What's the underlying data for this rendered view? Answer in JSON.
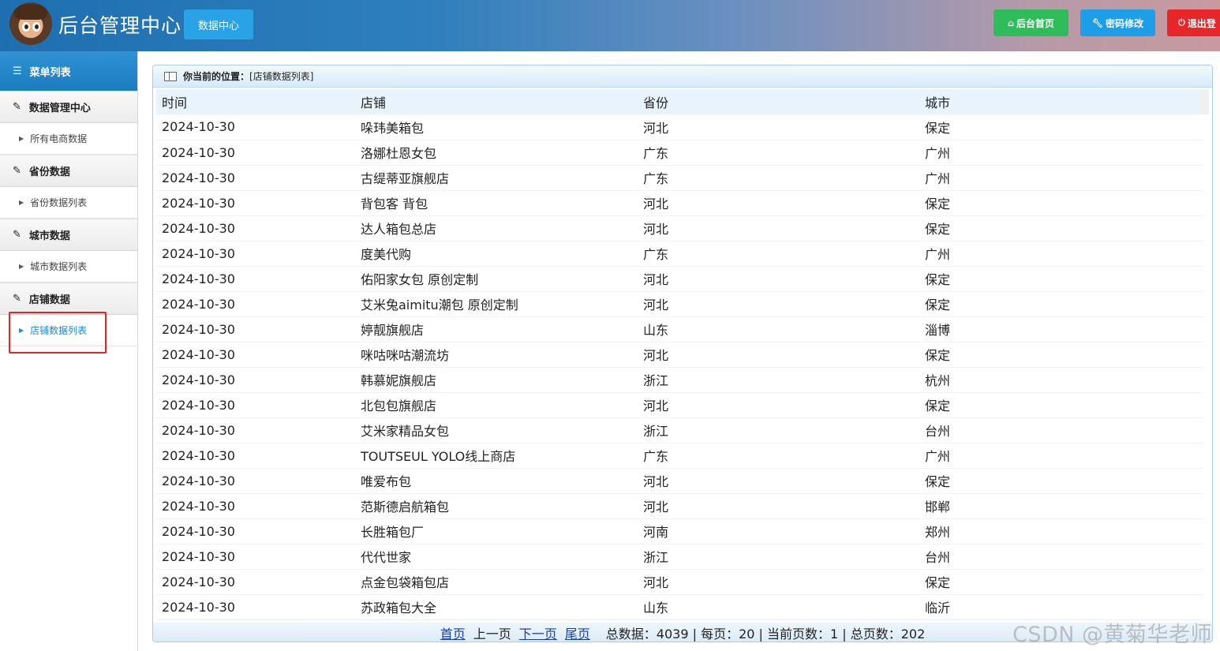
{
  "header": {
    "brand": "后台管理中心",
    "datacenter_label": "数据中心",
    "home_label": "后台首页",
    "password_label": "密码修改",
    "logout_label": "退出登",
    "home_icon": "home-icon",
    "password_icon": "wrench-icon",
    "logout_icon": "power-icon"
  },
  "sidebar": {
    "title": "菜单列表",
    "groups": [
      {
        "label": "数据管理中心",
        "sub": "所有电商数据"
      },
      {
        "label": "省份数据",
        "sub": "省份数据列表"
      },
      {
        "label": "城市数据",
        "sub": "城市数据列表"
      },
      {
        "label": "店铺数据",
        "sub": "店铺数据列表"
      }
    ]
  },
  "breadcrumb": {
    "label": "你当前的位置：",
    "value": "[店铺数据列表]"
  },
  "table": {
    "headers": [
      "时间",
      "店铺",
      "省份",
      "城市"
    ],
    "rows": [
      [
        "2024-10-30",
        "哚玮美箱包",
        "河北",
        "保定"
      ],
      [
        "2024-10-30",
        "洛娜杜恩女包",
        "广东",
        "广州"
      ],
      [
        "2024-10-30",
        "古缇蒂亚旗舰店",
        "广东",
        "广州"
      ],
      [
        "2024-10-30",
        "背包客 背包",
        "河北",
        "保定"
      ],
      [
        "2024-10-30",
        "达人箱包总店",
        "河北",
        "保定"
      ],
      [
        "2024-10-30",
        "度美代购",
        "广东",
        "广州"
      ],
      [
        "2024-10-30",
        "佑阳家女包 原创定制",
        "河北",
        "保定"
      ],
      [
        "2024-10-30",
        "艾米兔aimitu潮包 原创定制",
        "河北",
        "保定"
      ],
      [
        "2024-10-30",
        "婷靓旗舰店",
        "山东",
        "淄博"
      ],
      [
        "2024-10-30",
        "咪咕咪咕潮流坊",
        "河北",
        "保定"
      ],
      [
        "2024-10-30",
        "韩慕妮旗舰店",
        "浙江",
        "杭州"
      ],
      [
        "2024-10-30",
        "北包包旗舰店",
        "河北",
        "保定"
      ],
      [
        "2024-10-30",
        "艾米家精品女包",
        "浙江",
        "台州"
      ],
      [
        "2024-10-30",
        "TOUTSEUL YOLO线上商店",
        "广东",
        "广州"
      ],
      [
        "2024-10-30",
        "唯爱布包",
        "河北",
        "保定"
      ],
      [
        "2024-10-30",
        "范斯德启航箱包",
        "河北",
        "邯郸"
      ],
      [
        "2024-10-30",
        "长胜箱包厂",
        "河南",
        "郑州"
      ],
      [
        "2024-10-30",
        "代代世家",
        "浙江",
        "台州"
      ],
      [
        "2024-10-30",
        "点金包袋箱包店",
        "河北",
        "保定"
      ],
      [
        "2024-10-30",
        "苏政箱包大全",
        "山东",
        "临沂"
      ]
    ]
  },
  "pager": {
    "first": "首页",
    "prev": "上一页",
    "next": "下一页",
    "last": "尾页",
    "stats": "总数据：4039 | 每页：20 | 当前页数：1 | 总页数：202"
  },
  "watermark": "CSDN @黄菊华老师"
}
